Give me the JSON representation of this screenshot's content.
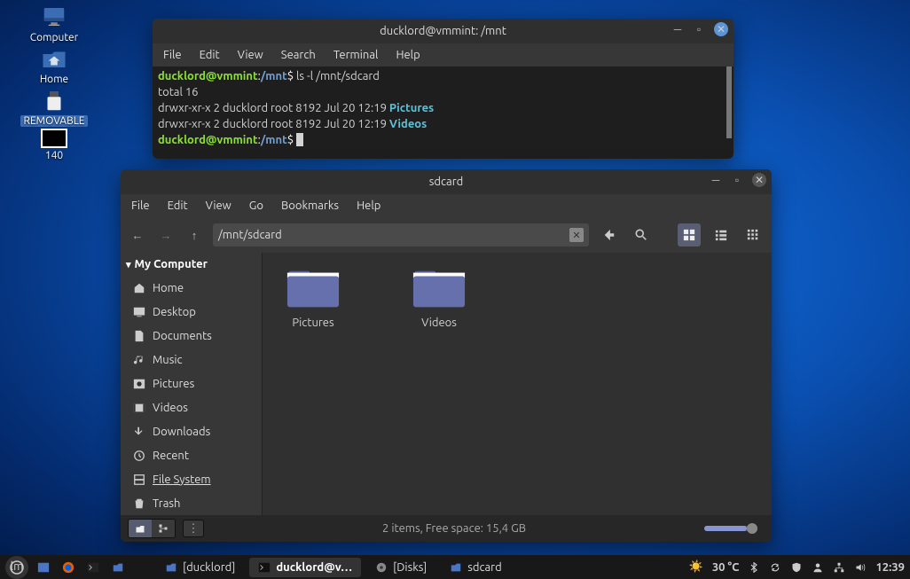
{
  "desktop": {
    "icons": [
      "Computer",
      "Home",
      "REMOVABLE",
      "140"
    ]
  },
  "terminal": {
    "title": "ducklord@vmmint: /mnt",
    "menu": [
      "File",
      "Edit",
      "View",
      "Search",
      "Terminal",
      "Help"
    ],
    "prompt_user": "ducklord@vmmint",
    "prompt_path": "/mnt",
    "cmd1": "ls -l /mnt/sdcard",
    "out_total": "total 16",
    "out_line1a": "drwxr-xr-x 2 ducklord root 8192 Jul 20 12:19 ",
    "out_line1b": "Pictures",
    "out_line2a": "drwxr-xr-x 2 ducklord root 8192 Jul 20 12:19 ",
    "out_line2b": "Videos"
  },
  "fm": {
    "title": "sdcard",
    "menu": [
      "File",
      "Edit",
      "View",
      "Go",
      "Bookmarks",
      "Help"
    ],
    "path": "/mnt/sdcard",
    "sidebar_header": "My Computer",
    "sidebar_items": [
      "Home",
      "Desktop",
      "Documents",
      "Music",
      "Pictures",
      "Videos",
      "Downloads",
      "Recent",
      "File System",
      "Trash"
    ],
    "folders": [
      "Pictures",
      "Videos"
    ],
    "status": "2 items, Free space: 15,4 GB"
  },
  "taskbar": {
    "tasks": [
      "[ducklord]",
      "ducklord@v…",
      "[Disks]",
      "sdcard"
    ],
    "temp": "30 °C",
    "clock": "12:39"
  }
}
